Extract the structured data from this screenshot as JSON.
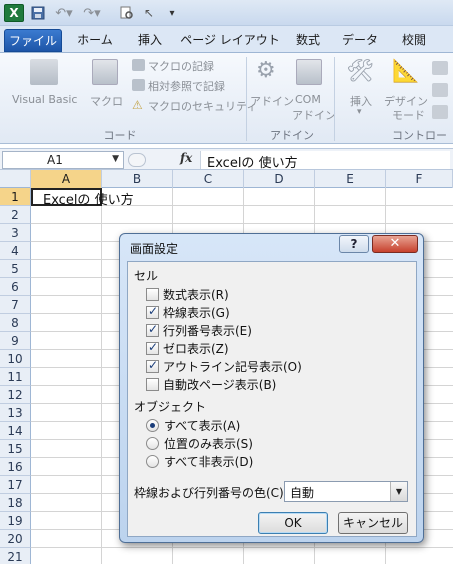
{
  "tabs": [
    "ファイル",
    "ホーム",
    "挿入",
    "ページ レイアウト",
    "数式",
    "データ",
    "校閲"
  ],
  "ribbon": {
    "visual_basic": "Visual Basic",
    "macro": "マクロ",
    "record_macro": "マクロの記録",
    "relative_ref": "相対参照で記録",
    "macro_security": "マクロのセキュリティ",
    "code_group": "コード",
    "addin": "アドイン",
    "com_addin_line1": "COM",
    "com_addin_line2": "アドイン",
    "addin_group": "アドイン",
    "insert": "挿入",
    "design_line1": "デザイン",
    "design_line2": "モード",
    "control_group": "コントロー"
  },
  "formula_bar": {
    "name_box": "A1",
    "fx": "fx",
    "formula": "Excelの 使い方"
  },
  "grid": {
    "columns": [
      "A",
      "B",
      "C",
      "D",
      "E",
      "F"
    ],
    "rows": [
      "1",
      "2",
      "3",
      "4",
      "5",
      "6",
      "7",
      "8",
      "9",
      "10",
      "11",
      "12",
      "13",
      "14",
      "15",
      "16",
      "17",
      "18",
      "19",
      "20",
      "21"
    ],
    "a1_text": "Excelの 使い方"
  },
  "dialog": {
    "title": "画面設定",
    "help": "?",
    "close": "✕",
    "cell_section": "セル",
    "checkboxes": [
      {
        "label": "数式表示(R)",
        "checked": false
      },
      {
        "label": "枠線表示(G)",
        "checked": true
      },
      {
        "label": "行列番号表示(E)",
        "checked": true
      },
      {
        "label": "ゼロ表示(Z)",
        "checked": true
      },
      {
        "label": "アウトライン記号表示(O)",
        "checked": true
      },
      {
        "label": "自動改ページ表示(B)",
        "checked": false
      }
    ],
    "object_section": "オブジェクト",
    "radios": [
      {
        "label": "すべて表示(A)",
        "checked": true
      },
      {
        "label": "位置のみ表示(S)",
        "checked": false
      },
      {
        "label": "すべて非表示(D)",
        "checked": false
      }
    ],
    "color_label": "枠線および行列番号の色(C):",
    "color_value": "自動",
    "ok": "OK",
    "cancel": "キャンセル"
  }
}
